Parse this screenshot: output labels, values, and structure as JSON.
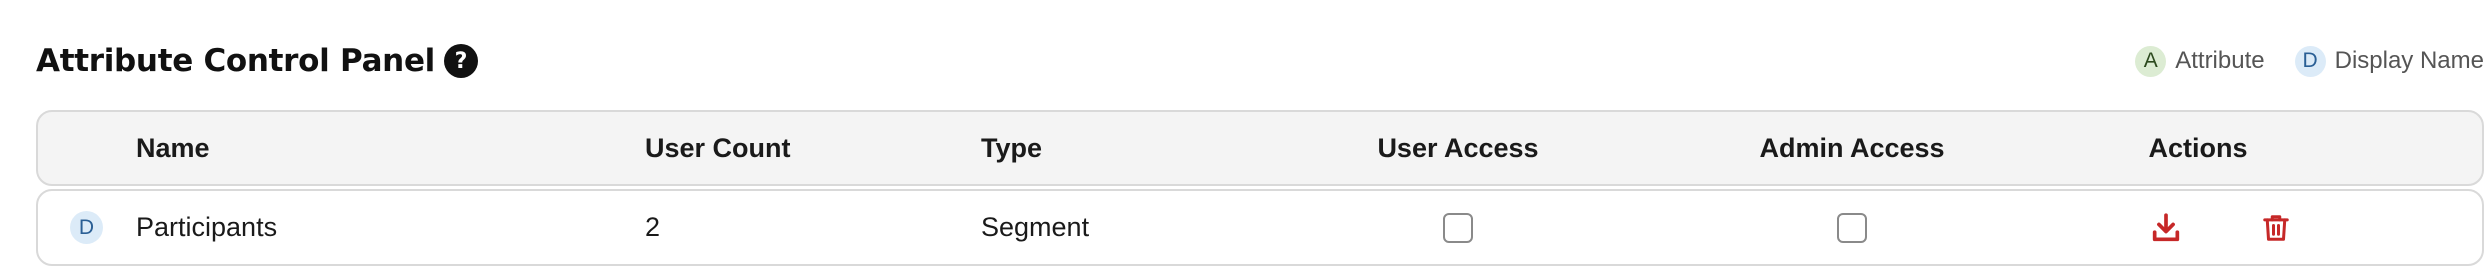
{
  "header": {
    "title": "Attribute Control Panel",
    "help_icon": "question-circle-icon"
  },
  "legend": [
    {
      "badge": "A",
      "label": "Attribute",
      "color": "#dcecd3"
    },
    {
      "badge": "D",
      "label": "Display Name",
      "color": "#dcebf8"
    }
  ],
  "table": {
    "columns": [
      "Name",
      "User Count",
      "Type",
      "User Access",
      "Admin Access",
      "Actions"
    ],
    "rows": [
      {
        "badge": "D",
        "name": "Participants",
        "user_count": "2",
        "type": "Segment",
        "user_access": false,
        "admin_access": false,
        "actions": [
          "download-icon",
          "trash-icon"
        ]
      }
    ]
  },
  "colors": {
    "action_red": "#c62828",
    "header_bg": "#f4f4f4",
    "border": "#d9d9d9"
  }
}
